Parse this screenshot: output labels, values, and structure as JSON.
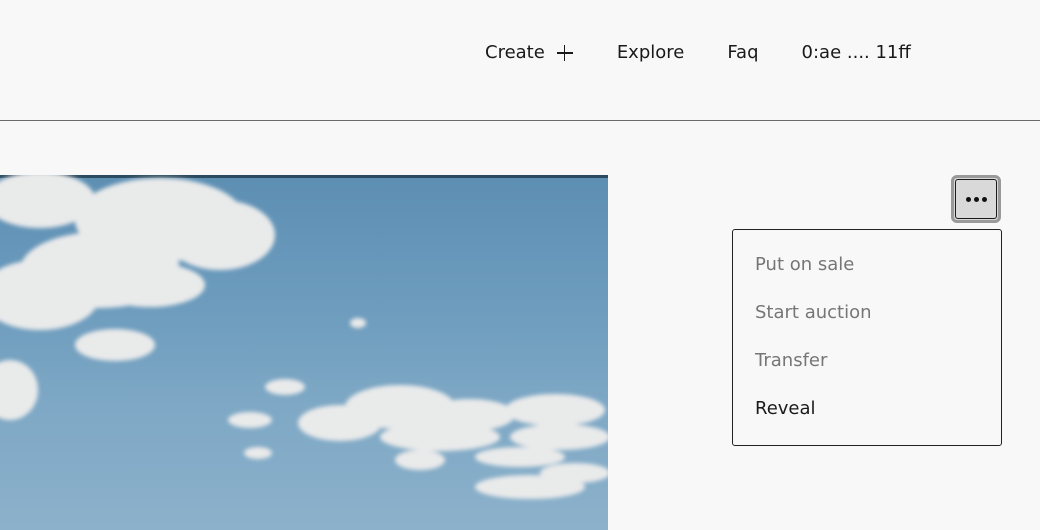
{
  "nav": {
    "create_label": "Create",
    "explore_label": "Explore",
    "faq_label": "Faq",
    "wallet_address": "0:ae .... 11ff"
  },
  "more_menu": {
    "items": [
      {
        "label": "Put on sale",
        "enabled": false
      },
      {
        "label": "Start auction",
        "enabled": false
      },
      {
        "label": "Transfer",
        "enabled": false
      },
      {
        "label": "Reveal",
        "enabled": true
      }
    ]
  },
  "icons": {
    "create": "plus-icon",
    "more": "more-dots-icon"
  },
  "colors": {
    "background": "#f8f8f8",
    "text": "#1a1a1a",
    "disabled_text": "#767676",
    "sky": "#6c9bbd"
  }
}
